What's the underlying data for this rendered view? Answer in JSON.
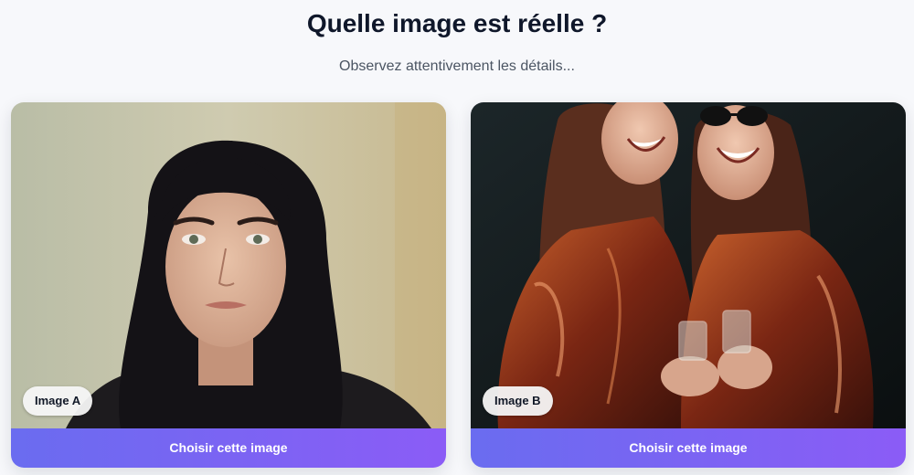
{
  "header": {
    "title": "Quelle image est réelle ?",
    "subtitle": "Observez attentivement les détails..."
  },
  "cards": [
    {
      "badge": "Image A",
      "button_label": "Choisir cette image",
      "photo": "portrait of a young woman with long black hair in a dark hoodie"
    },
    {
      "badge": "Image B",
      "button_label": "Choisir cette image",
      "photo": "two laughing women in shiny red leather jackets holding glasses"
    }
  ],
  "colors": {
    "page_bg": "#f7f8fb",
    "button_gradient_start": "#6a6cf0",
    "button_gradient_end": "#8b5cf6",
    "badge_bg": "#f5f5f5"
  }
}
